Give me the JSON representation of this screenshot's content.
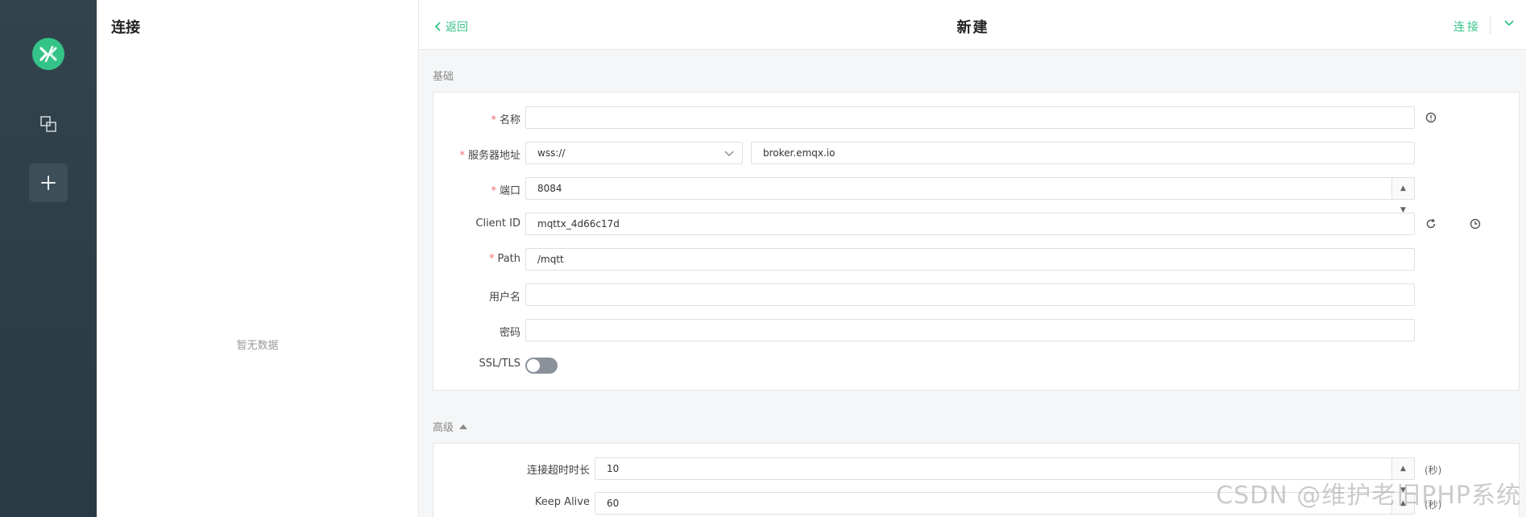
{
  "sidebar": {
    "logo_icon": "mqttx-logo",
    "items": [
      {
        "icon": "connections-icon"
      },
      {
        "icon": "plus-icon"
      }
    ]
  },
  "connections_panel": {
    "title": "连接",
    "empty_text": "暂无数据"
  },
  "header": {
    "back_label": "返回",
    "title": "新建",
    "connect_label": "连接"
  },
  "basic": {
    "section_label": "基础",
    "name": {
      "label": "名称",
      "required": true,
      "value": ""
    },
    "host": {
      "label": "服务器地址",
      "required": true,
      "protocol": "wss://",
      "value": "broker.emqx.io"
    },
    "port": {
      "label": "端口",
      "required": true,
      "value": "8084"
    },
    "client_id": {
      "label": "Client ID",
      "required": false,
      "value": "mqttx_4d66c17d"
    },
    "path": {
      "label": "Path",
      "required": true,
      "value": "/mqtt"
    },
    "username": {
      "label": "用户名",
      "required": false,
      "value": ""
    },
    "password": {
      "label": "密码",
      "required": false,
      "value": ""
    },
    "ssl": {
      "label": "SSL/TLS",
      "enabled": false
    }
  },
  "advanced": {
    "section_label": "高级",
    "connect_timeout": {
      "label": "连接超时时长",
      "value": "10",
      "unit": "(秒)"
    },
    "keep_alive": {
      "label": "Keep Alive",
      "value": "60",
      "unit": "(秒)"
    }
  },
  "watermark": "CSDN @维护老旧PHP系统",
  "colors": {
    "accent": "#34c388",
    "required": "#f56c6c",
    "rail": "#2f404a"
  }
}
